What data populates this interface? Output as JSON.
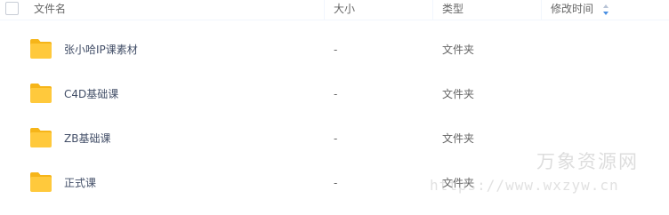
{
  "header": {
    "name_label": "文件名",
    "size_label": "大小",
    "type_label": "类型",
    "modified_label": "修改时间",
    "sort_icon": "sort-updown-icon"
  },
  "colors": {
    "folder": "#ffc93c",
    "folder_dark": "#f6b519",
    "sort_active": "#4a90e2"
  },
  "files": [
    {
      "name": "张小哈IP课素材",
      "size": "-",
      "type": "文件夹",
      "icon": "folder-icon"
    },
    {
      "name": "C4D基础课",
      "size": "-",
      "type": "文件夹",
      "icon": "folder-icon"
    },
    {
      "name": "ZB基础课",
      "size": "-",
      "type": "文件夹",
      "icon": "folder-icon"
    },
    {
      "name": "正式课",
      "size": "-",
      "type": "文件夹",
      "icon": "folder-icon"
    }
  ],
  "watermark": {
    "title": "万象资源网",
    "url": "https://www.wxzyw.cn"
  }
}
